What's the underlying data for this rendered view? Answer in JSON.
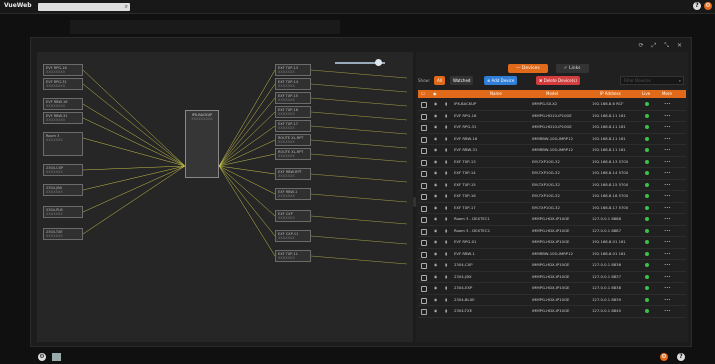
{
  "app": {
    "title": "VueWeb"
  },
  "icons": {
    "search": "magnifier-icon",
    "help": "question-icon",
    "settings": "gear-icon",
    "window": [
      "refresh-icon",
      "expand-icon",
      "collapse-icon",
      "close-icon"
    ]
  },
  "colors": {
    "accent": "#e06a1a",
    "add": "#2f7fd8",
    "delete": "#d33c3c",
    "live": "#3bbf4a"
  },
  "graph": {
    "center": {
      "title": "IPX-BACKUP",
      "subtitle": "XXXXXXXXX"
    },
    "left_nodes": [
      {
        "label": "EVF RPG-16",
        "sub": "XXXXXXXX"
      },
      {
        "label": "EVF RPG-31",
        "sub": "XXXXXXXX"
      },
      {
        "label": "EVF RBW-16",
        "sub": "XXXXXXXX"
      },
      {
        "label": "EVF RBW-31",
        "sub": "XXXXXXXX"
      },
      {
        "label": "Room 3",
        "sub": "XXXXXXX"
      },
      {
        "label": "2304-CXP",
        "sub": "XXXXXXX"
      },
      {
        "label": "2304-JBX",
        "sub": "XXXXXXX"
      },
      {
        "label": "2304-PLB",
        "sub": "XXXXXXX"
      },
      {
        "label": "2304-TXE",
        "sub": "XXXXXXX"
      }
    ],
    "right_nodes": [
      {
        "label": "EXF TXP-13",
        "sub": "XXXXXXX"
      },
      {
        "label": "EXF TXP-14",
        "sub": "XXXXXXX"
      },
      {
        "label": "EXF TXP-15",
        "sub": "XXXXXXX"
      },
      {
        "label": "EXF TXP-16",
        "sub": "XXXXXXX"
      },
      {
        "label": "EXF TXP-17",
        "sub": "XXXXXXX"
      },
      {
        "label": "ROUTE XL-RPT",
        "sub": "XXXXXXX"
      },
      {
        "label": "ROUTE XL-RPT",
        "sub": "XXXXXXX"
      },
      {
        "label": "EXF RBW-RPT",
        "sub": "XXXXXXX"
      },
      {
        "label": "EXF RBW-1",
        "sub": "XXXXXXX"
      },
      {
        "label": "EXF CXP",
        "sub": "XXXXXXX"
      },
      {
        "label": "EXF CXP-11",
        "sub": "XXXXXXX"
      },
      {
        "label": "EXF TXP-11",
        "sub": "XXXXXXX"
      }
    ]
  },
  "panel": {
    "tabs": [
      {
        "label": "— Devices"
      },
      {
        "label": "✓ Links"
      }
    ],
    "show_label": "Show:",
    "filter_all": "All",
    "filter_watched": "Watched",
    "add_label": "⊕ Add Device",
    "delete_label": "✖ Delete Device(s)",
    "filter_placeholder": "Filter Devices",
    "columns": [
      "Name",
      "Model",
      "IP Address",
      "Live",
      "More"
    ],
    "rows": [
      {
        "name": "IPX-BACKUP",
        "model": "IMMPG-SX-X2",
        "ip": "192.168.8.6 RCF"
      },
      {
        "name": "EVF RPG-16",
        "model": "IMMPG-HD10-IP10GE",
        "ip": "192.168.8.11 161"
      },
      {
        "name": "EVF RPG-31",
        "model": "IMMPG-HD10-IP10GE",
        "ip": "192.168.8.11 161"
      },
      {
        "name": "EVF RBW-16",
        "model": "IMMRBW-10G-IMRP12",
        "ip": "192.168.8.11 161"
      },
      {
        "name": "EVF RBW-31",
        "model": "IMMRBW-10G-IMRP12",
        "ip": "192.168.8.11 161"
      },
      {
        "name": "EXF TXP-13",
        "model": "EM-TXP10G-32",
        "ip": "192.168.8.13 5700"
      },
      {
        "name": "EXF TXP-14",
        "model": "EM-TXP10G-32",
        "ip": "192.168.8.14 5700"
      },
      {
        "name": "EXF TXP-15",
        "model": "EM-TXP10G-32",
        "ip": "192.168.8.15 5700"
      },
      {
        "name": "EXF TXP-16",
        "model": "EM-TXP10G-32",
        "ip": "192.168.8.16 5700"
      },
      {
        "name": "EXF TXP-17",
        "model": "EM-TXP10G-32",
        "ip": "192.168.8.17 5700"
      },
      {
        "name": "Room 3 - DEXTEC1",
        "model": "IMMPG-HDX-IP10GE",
        "ip": "127.0.0.1 8888"
      },
      {
        "name": "Room 3 - DEXTEC2",
        "model": "IMMPG-HDX-IP10GE",
        "ip": "127.0.0.1 8887"
      },
      {
        "name": "EVF RPG-01",
        "model": "IMMPG-HDX-IP10GE",
        "ip": "192.168.8.01 161"
      },
      {
        "name": "EVF RBW-1",
        "model": "IMMRBW-10G-IMRP12",
        "ip": "192.168.8.01 161"
      },
      {
        "name": "2304-CXP",
        "model": "IMMPG-HDX-IP10GE",
        "ip": "127.0.0.1 8836"
      },
      {
        "name": "2304-JBX",
        "model": "IMMPG-HDX-IP10GE",
        "ip": "127.0.0.1 8837"
      },
      {
        "name": "2304-EXP",
        "model": "IMMPG-HDX-IP10GE",
        "ip": "127.0.0.1 8838"
      },
      {
        "name": "2304-BLXE",
        "model": "IMMPG-HDX-IP10GE",
        "ip": "127.0.0.1 8839"
      },
      {
        "name": "2304-TXE",
        "model": "IMMPG-HDX-IP10GE",
        "ip": "127.0.0.1 8840"
      }
    ]
  }
}
